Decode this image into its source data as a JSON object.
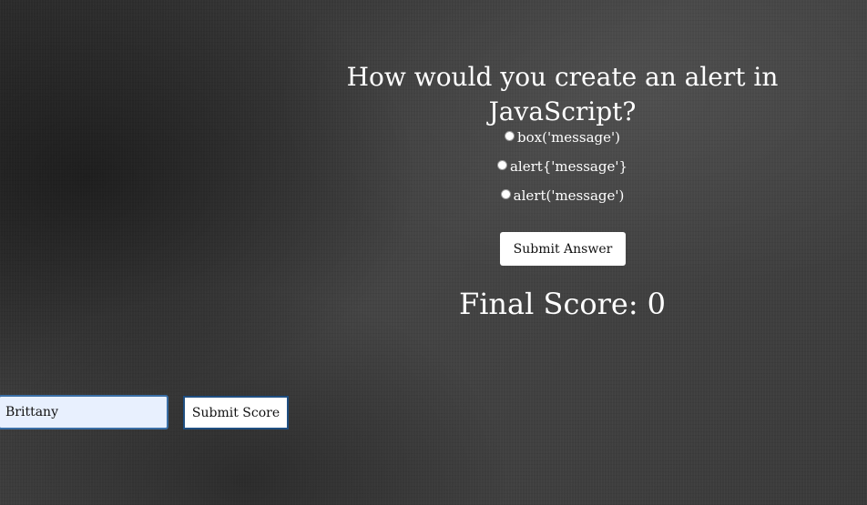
{
  "quiz": {
    "question": "How would you create an alert in JavaScript?",
    "choices": [
      {
        "label": "box('message')",
        "selected": false
      },
      {
        "label": "alert{'message'}",
        "selected": false
      },
      {
        "label": "alert('message')",
        "selected": false
      }
    ],
    "submit_answer_label": "Submit Answer"
  },
  "score": {
    "label": "Final Score:",
    "value": "0"
  },
  "highscore_form": {
    "name_value": "Brittany",
    "submit_label": "Submit Score"
  }
}
